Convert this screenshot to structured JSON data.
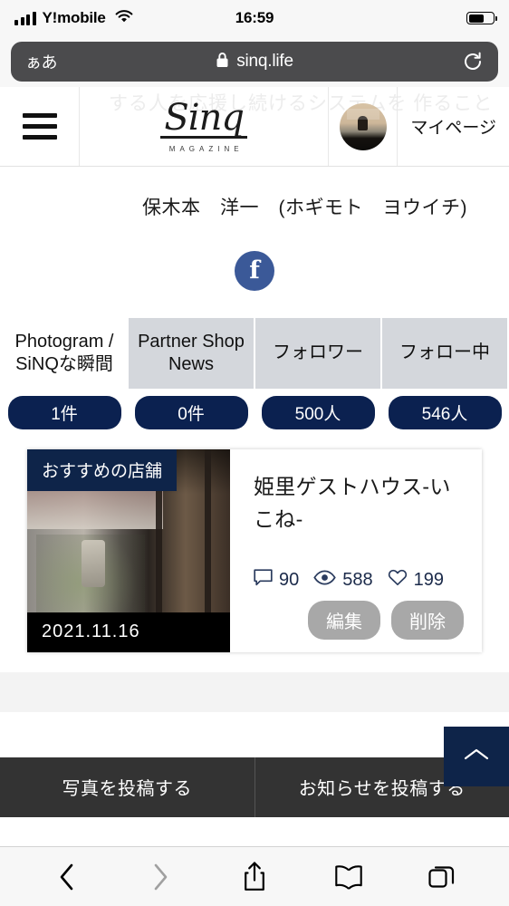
{
  "statusbar": {
    "carrier": "Y!mobile",
    "time": "16:59",
    "signal_icon": "cellular-bars-icon",
    "wifi_icon": "wifi-icon",
    "battery_icon": "battery-icon"
  },
  "browser": {
    "text_size_label": "ぁあ",
    "lock_icon": "lock-icon",
    "url": "sinq.life",
    "reload_icon": "reload-icon",
    "toolbar": {
      "back_icon": "back-chevron-icon",
      "forward_icon": "forward-chevron-icon",
      "share_icon": "share-icon",
      "bookmarks_icon": "bookmarks-book-icon",
      "tabs_icon": "tabs-icon"
    }
  },
  "header": {
    "menu_icon": "hamburger-menu-icon",
    "logo_text": "Sinq",
    "logo_sub": "MAGAZINE",
    "ghost_text": "する人を応援し続けるシステムを 作ること",
    "avatar_icon": "user-avatar",
    "mypage_label": "マイページ"
  },
  "profile": {
    "name": "保木本　洋一　(ホギモト　ヨウイチ)",
    "facebook_icon": "facebook-icon",
    "facebook_glyph": "f"
  },
  "tabs": [
    {
      "label": "Photogram / SiNQな瞬間",
      "count": "1件",
      "active": true
    },
    {
      "label": "Partner Shop News",
      "count": "0件",
      "active": false
    },
    {
      "label": "フォロワー",
      "count": "500人",
      "active": false
    },
    {
      "label": "フォロー中",
      "count": "546人",
      "active": false
    }
  ],
  "post": {
    "recommend_badge": "おすすめの店舗",
    "date": "2021.11.16",
    "title": "姫里ゲストハウス-いこね-",
    "stats": {
      "comments_icon": "comment-bubble-icon",
      "comments": "90",
      "views_icon": "eye-icon",
      "views": "588",
      "likes_icon": "heart-icon",
      "likes": "199"
    },
    "edit_label": "編集",
    "delete_label": "削除"
  },
  "scroll_top": {
    "icon": "chevron-up-icon"
  },
  "footer": {
    "post_photo_label": "写真を投稿する",
    "post_news_label": "お知らせを投稿する"
  },
  "colors": {
    "navy": "#0b2150",
    "navy_dark": "#0e2449",
    "tab_gray": "#d4d7dc",
    "pill_gray": "#a8a8a8",
    "footer_dark": "#333333",
    "facebook_blue": "#3b5998"
  }
}
